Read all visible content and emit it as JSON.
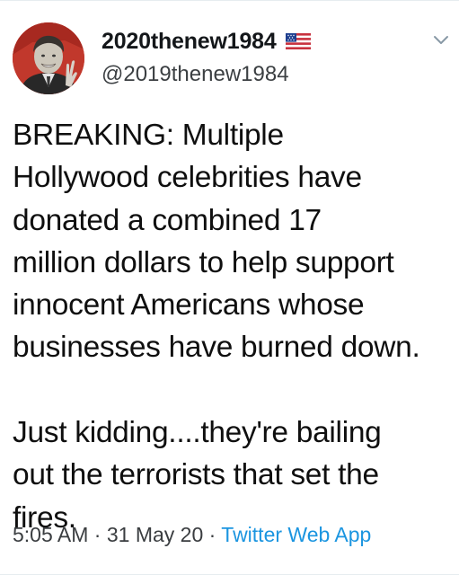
{
  "user": {
    "display_name": "2020thenew1984",
    "handle": "@2019thenew1984",
    "avatar_icon": "avatar-portrait-icon",
    "flag_icon": "us-flag-icon"
  },
  "menu": {
    "caret_icon": "chevron-down-icon"
  },
  "tweet": {
    "text": "BREAKING:  Multiple\nHollywood celebrities have\ndonated a combined 17\nmillion dollars to help support\ninnocent Americans whose\nbusinesses have burned down.\n\nJust kidding....they're bailing\nout the terrorists that set the\nfires."
  },
  "meta": {
    "time": "5:05 AM",
    "separator": "·",
    "date": "31 May 20",
    "source": "Twitter Web App"
  },
  "colors": {
    "link": "#1b95e0",
    "border": "#e6ecf0",
    "avatar_background": "#d23a2e"
  }
}
